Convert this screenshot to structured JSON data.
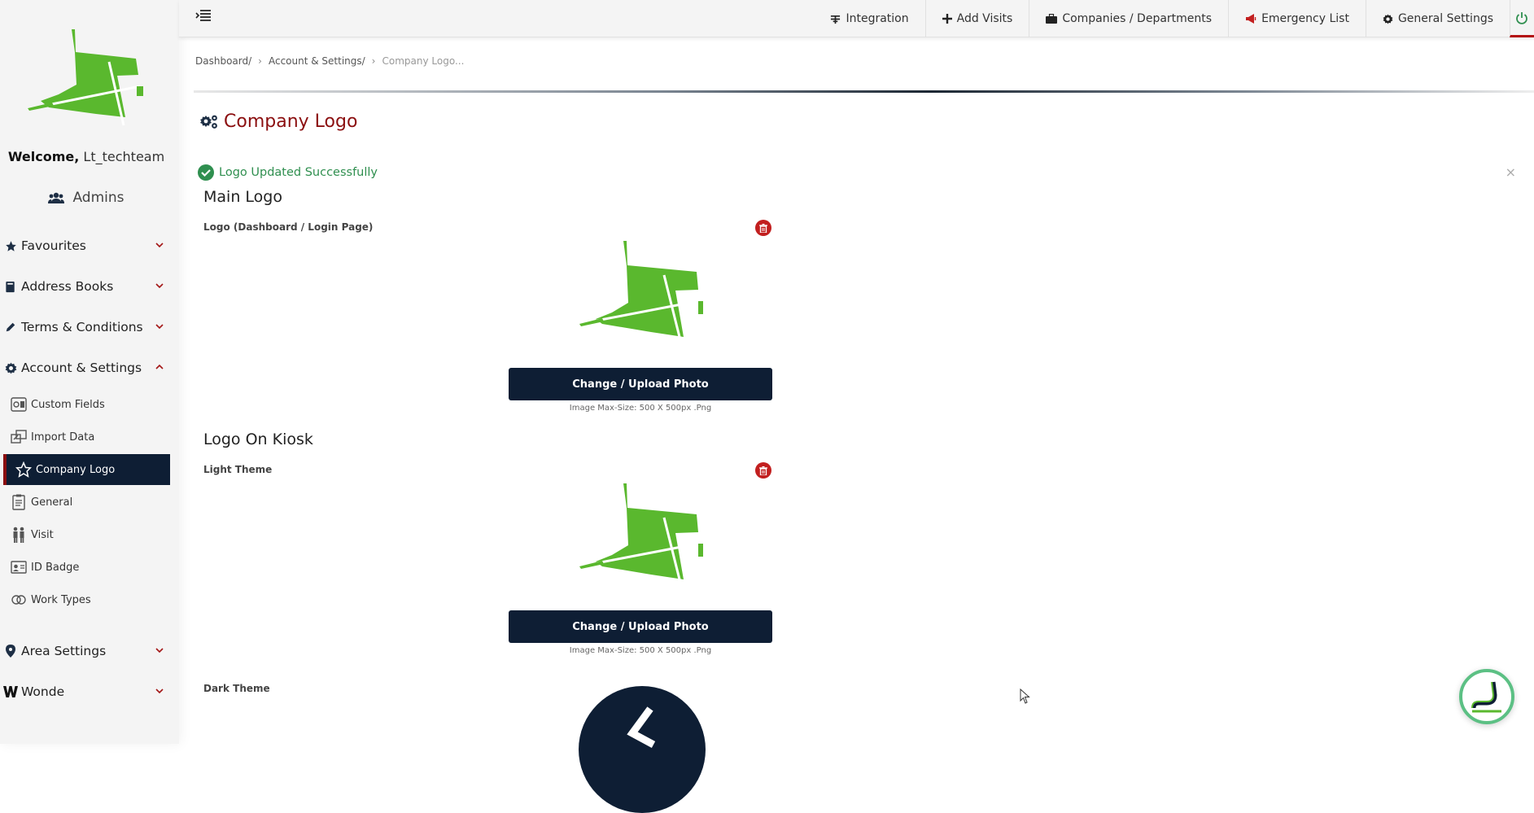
{
  "colors": {
    "accent_red": "#8b0f10",
    "navy": "#0e1e34",
    "brand_green": "#5ab82e",
    "success_green": "#2f8f4f"
  },
  "sidebar": {
    "welcome_prefix": "Welcome,",
    "welcome_user": "Lt_techteam",
    "admins_label": "Admins",
    "menu": [
      {
        "label": "Favourites",
        "icon": "star-icon",
        "expanded": false
      },
      {
        "label": "Address Books",
        "icon": "book-icon",
        "expanded": false
      },
      {
        "label": "Terms & Conditions",
        "icon": "pencil-icon",
        "expanded": false
      },
      {
        "label": "Account & Settings",
        "icon": "gear-icon",
        "expanded": true
      },
      {
        "label": "Area Settings",
        "icon": "map-pin-icon",
        "expanded": false
      },
      {
        "label": "Wonde",
        "icon": "wonde-w-icon",
        "expanded": false
      }
    ],
    "submenu": [
      {
        "label": "Custom Fields",
        "icon": "custom-fields-icon"
      },
      {
        "label": "Import Data",
        "icon": "import-data-icon"
      },
      {
        "label": "Company Logo",
        "icon": "company-logo-star-icon",
        "active": true
      },
      {
        "label": "General",
        "icon": "clipboard-icon"
      },
      {
        "label": "Visit",
        "icon": "people-icon"
      },
      {
        "label": "ID Badge",
        "icon": "id-badge-icon"
      },
      {
        "label": "Work Types",
        "icon": "work-types-icon"
      }
    ]
  },
  "topbar": {
    "items": [
      {
        "label": "Integration",
        "icon": "integration-icon"
      },
      {
        "label": "Add Visits",
        "icon": "plus-icon"
      },
      {
        "label": "Companies / Departments",
        "icon": "briefcase-icon"
      },
      {
        "label": "Emergency List",
        "icon": "megaphone-icon"
      },
      {
        "label": "General Settings",
        "icon": "gear-icon"
      }
    ],
    "power_icon": "power-icon"
  },
  "breadcrumb": {
    "items": [
      "Dashboard/",
      "Account & Settings/"
    ],
    "current": "Company Logo..."
  },
  "page": {
    "title": "Company Logo",
    "alert": "Logo Updated Successfully",
    "main_logo": {
      "section_title": "Main Logo",
      "field_label": "Logo (Dashboard / Login Page)",
      "button_label": "Change / Upload Photo",
      "hint": "Image Max-Size: 500 X 500px .Png"
    },
    "kiosk": {
      "section_title": "Logo On Kiosk",
      "light_label": "Light Theme",
      "button_label": "Change / Upload Photo",
      "hint": "Image Max-Size: 500 X 500px .Png",
      "dark_label": "Dark Theme"
    }
  }
}
